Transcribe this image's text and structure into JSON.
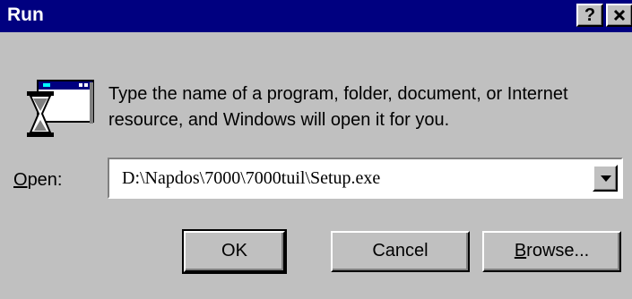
{
  "window": {
    "title": "Run",
    "help_label": "?",
    "close_label": "✕"
  },
  "description": "Type the name of a program, folder, document, or Internet resource, and Windows will open it for you.",
  "open_field": {
    "label_underlined": "O",
    "label_rest": "pen:",
    "value": "D:\\Napdos\\7000\\7000tuil\\Setup.exe"
  },
  "buttons": {
    "ok_label": "OK",
    "cancel_label": "Cancel",
    "browse_underlined": "B",
    "browse_rest": "rowse..."
  },
  "icons": {
    "run": "run-hourglass-icon",
    "dropdown": "chevron-down-icon"
  },
  "colors": {
    "titlebar": "#000080",
    "face": "#c0c0c0"
  }
}
